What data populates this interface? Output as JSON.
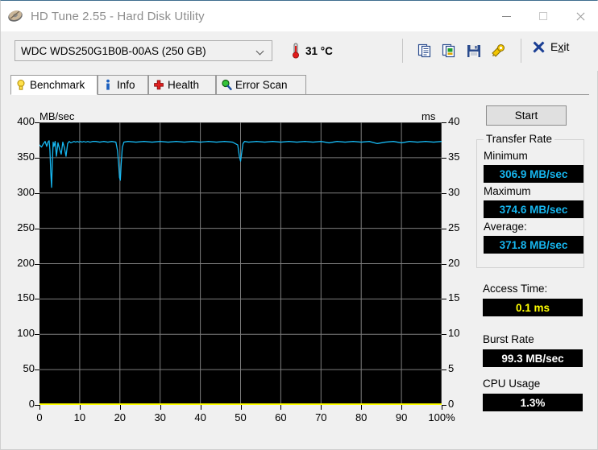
{
  "window": {
    "title": "HD Tune 2.55 - Hard Disk Utility",
    "icon": "harddisk-icon",
    "minimize": "minimize-icon",
    "maximize": "maximize-icon",
    "close": "close-icon"
  },
  "toolbar": {
    "drive_selected": "WDC    WDS250G1B0B-00AS (250 GB)",
    "temperature": "31 °C",
    "thermometer_icon": "thermometer-icon",
    "icons": [
      {
        "name": "copy-icon",
        "title": "Copy"
      },
      {
        "name": "copy-image-icon",
        "title": "Copy image"
      },
      {
        "name": "save-icon",
        "title": "Save"
      },
      {
        "name": "options-icon",
        "title": "Options"
      }
    ],
    "exit_label_pre": "E",
    "exit_label_accel": "x",
    "exit_label_post": "it"
  },
  "tabs": [
    {
      "label": "Benchmark",
      "icon": "bulb-icon",
      "active": true
    },
    {
      "label": "Info",
      "icon": "info-icon",
      "active": false
    },
    {
      "label": "Health",
      "icon": "health-cross-icon",
      "active": false
    },
    {
      "label": "Error Scan",
      "icon": "magnifier-icon",
      "active": false
    }
  ],
  "sidebar": {
    "start_label": "Start",
    "transfer_rate": {
      "group_title": "Transfer Rate",
      "minimum_label": "Minimum",
      "minimum_value": "306.9 MB/sec",
      "maximum_label": "Maximum",
      "maximum_value": "374.6 MB/sec",
      "average_label": "Average:",
      "average_value": "371.8 MB/sec"
    },
    "access_time_label": "Access Time:",
    "access_time_value": "0.1 ms",
    "burst_rate_label": "Burst Rate",
    "burst_rate_value": "99.3 MB/sec",
    "cpu_usage_label": "CPU Usage",
    "cpu_usage_value": "1.3%"
  },
  "colors": {
    "transfer_line": "#16b6ef",
    "access_line": "#ffff00",
    "plot_background": "#000000",
    "grid": "#7d7d7d",
    "value_cyan": "#16b6ef",
    "value_yellow": "#ffff00",
    "value_white": "#ffffff"
  },
  "chart_data": {
    "type": "line",
    "title": "",
    "xlabel": "",
    "ylabel": "MB/sec",
    "y2label": "ms",
    "xlim": [
      0,
      100
    ],
    "ylim": [
      0,
      400
    ],
    "y2lim": [
      0,
      40
    ],
    "grid": true,
    "legend": null,
    "xticks": [
      0,
      10,
      20,
      30,
      40,
      50,
      60,
      70,
      80,
      90,
      100
    ],
    "xticklabels": [
      "0",
      "10",
      "20",
      "30",
      "40",
      "50",
      "60",
      "70",
      "80",
      "90",
      "100%"
    ],
    "yticks": [
      0,
      50,
      100,
      150,
      200,
      250,
      300,
      350,
      400
    ],
    "yticklabels": [
      "0",
      "50",
      "100",
      "150",
      "200",
      "250",
      "300",
      "350",
      "400"
    ],
    "y2ticks": [
      0,
      5,
      10,
      15,
      20,
      25,
      30,
      35,
      40
    ],
    "y2ticklabels": [
      "0",
      "5",
      "10",
      "15",
      "20",
      "25",
      "30",
      "35",
      "40"
    ],
    "series": [
      {
        "name": "Transfer rate",
        "axis": "left",
        "unit": "MB/sec",
        "color": "#16b6ef",
        "x": [
          0,
          0.5,
          1.0,
          1.4,
          1.8,
          2.1,
          2.4,
          2.6,
          2.8,
          3.0,
          3.2,
          3.4,
          3.6,
          3.9,
          4.2,
          4.6,
          5.0,
          5.4,
          5.8,
          6.2,
          6.6,
          7.0,
          7.4,
          7.8,
          8.2,
          8.6,
          9.0,
          9.4,
          9.8,
          10.2,
          10.6,
          11.0,
          11.5,
          12.0,
          12.6,
          13.2,
          14.0,
          15.0,
          16.0,
          17.0,
          18.0,
          19.0,
          19.4,
          19.7,
          19.9,
          20.1,
          20.3,
          20.6,
          21.0,
          22.0,
          24.0,
          26.0,
          28.0,
          30.0,
          32.0,
          34.0,
          36.0,
          38.0,
          40.0,
          42.0,
          44.0,
          46.0,
          48.0,
          49.3,
          49.7,
          50.0,
          50.3,
          50.6,
          51.0,
          52.0,
          54.0,
          56.0,
          58.0,
          60.0,
          62.0,
          64.0,
          66.0,
          68.0,
          70.0,
          72.0,
          74.0,
          76.0,
          78.0,
          80.0,
          82.0,
          84.0,
          86.0,
          88.0,
          90.0,
          92.0,
          94.0,
          96.0,
          98.0,
          100.0
        ],
        "y": [
          368,
          365,
          370,
          373,
          366,
          372,
          374,
          360,
          330,
          308,
          345,
          372,
          366,
          373,
          352,
          371,
          362,
          355,
          372,
          364,
          352,
          370,
          373,
          371,
          372,
          373,
          372,
          373,
          372,
          373,
          372,
          373,
          372,
          373,
          372,
          373,
          373,
          372,
          373,
          372,
          373,
          372,
          360,
          340,
          322,
          318,
          340,
          365,
          372,
          373,
          372,
          373,
          372,
          373,
          372,
          373,
          372,
          373,
          372,
          373,
          372,
          373,
          372,
          368,
          352,
          345,
          358,
          370,
          373,
          372,
          373,
          372,
          373,
          372,
          373,
          372,
          373,
          372,
          373,
          371,
          373,
          372,
          373,
          372,
          373,
          370,
          372,
          373,
          371,
          373,
          372,
          373,
          372,
          373
        ]
      },
      {
        "name": "Access time",
        "axis": "right",
        "unit": "ms",
        "color": "#ffff00",
        "x": [
          0,
          5,
          10,
          15,
          20,
          25,
          30,
          35,
          40,
          45,
          50,
          55,
          60,
          65,
          70,
          75,
          80,
          85,
          90,
          95,
          100
        ],
        "y": [
          0.1,
          0.1,
          0.1,
          0.1,
          0.1,
          0.1,
          0.1,
          0.1,
          0.1,
          0.1,
          0.1,
          0.1,
          0.1,
          0.1,
          0.1,
          0.1,
          0.1,
          0.1,
          0.1,
          0.1,
          0.1
        ]
      }
    ],
    "summary": {
      "minimum_mbs": 306.9,
      "maximum_mbs": 374.6,
      "average_mbs": 371.8,
      "access_time_ms": 0.1,
      "burst_rate_mbs": 99.3,
      "cpu_usage_percent": 1.3
    }
  }
}
